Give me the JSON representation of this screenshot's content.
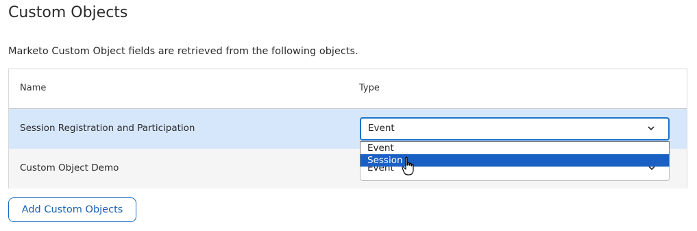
{
  "section": {
    "title": "Custom Objects",
    "description": "Marketo Custom Object fields are retrieved from the following objects."
  },
  "table": {
    "columns": [
      "Name",
      "Type"
    ],
    "rows": [
      {
        "name": "Session Registration and Participation",
        "type": "Event"
      },
      {
        "name": "Custom Object Demo",
        "type": "Event"
      }
    ]
  },
  "dropdown": {
    "options": [
      "Event",
      "Session"
    ],
    "highlighted": "Session"
  },
  "buttons": {
    "add": "Add Custom Objects"
  },
  "icons": {
    "chevron": "chevron-down-icon",
    "cursor": "hand-pointer-icon"
  },
  "colors": {
    "accent": "#1a73c8",
    "selected_row": "#d6e6fb",
    "highlight": "#1a5fc4"
  }
}
